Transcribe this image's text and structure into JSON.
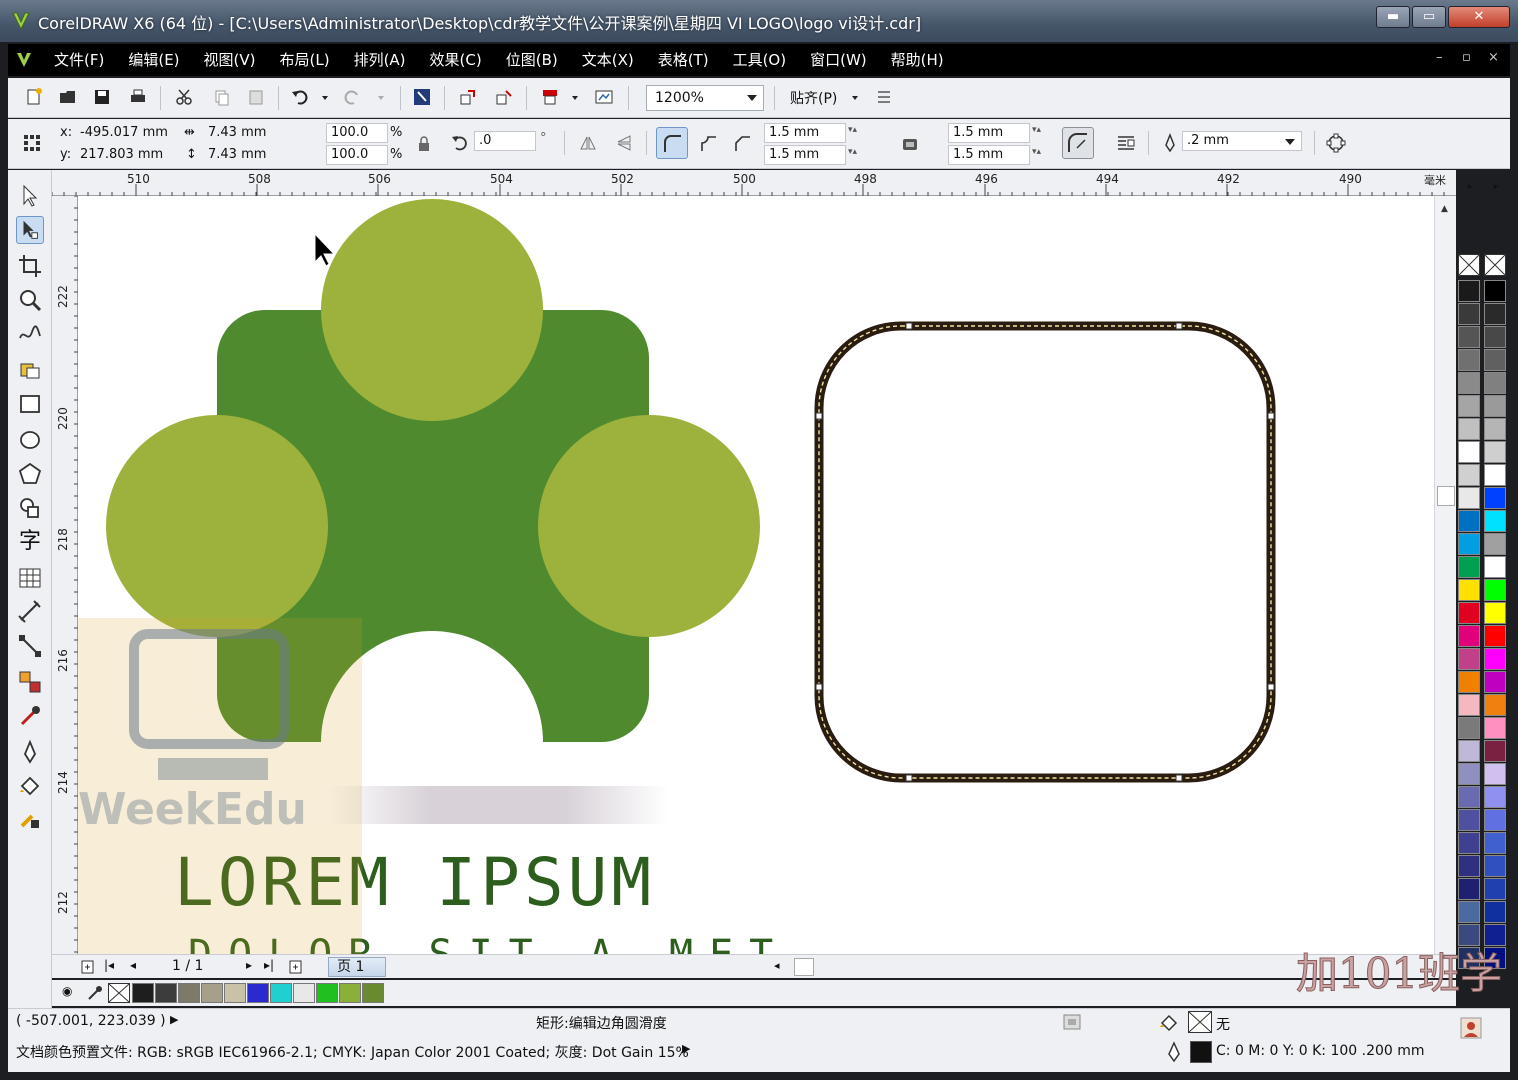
{
  "window": {
    "title": "CorelDRAW X6 (64 位) - [C:\\Users\\Administrator\\Desktop\\cdr教学文件\\公开课案例\\星期四 VI LOGO\\logo vi设计.cdr]",
    "minimize": "▬",
    "maximize": "▭",
    "close": "✕"
  },
  "menu": {
    "items": [
      "文件(F)",
      "编辑(E)",
      "视图(V)",
      "布局(L)",
      "排列(A)",
      "效果(C)",
      "位图(B)",
      "文本(X)",
      "表格(T)",
      "工具(O)",
      "窗口(W)",
      "帮助(H)"
    ],
    "doc_controls": [
      "–",
      "▫",
      "×"
    ]
  },
  "toolbar": {
    "zoom": "1200%",
    "snap_label": "贴齐(P)"
  },
  "properties": {
    "x_label": "x:",
    "x_value": "-495.017 mm",
    "y_label": "y:",
    "y_value": "217.803 mm",
    "width": "7.43 mm",
    "height": "7.43 mm",
    "scale_x": "100.0",
    "scale_y": "100.0",
    "percent": "%",
    "rotation": ".0",
    "degree": "°",
    "corner_tl": "1.5 mm",
    "corner_bl": "1.5 mm",
    "corner_tr": "1.5 mm",
    "corner_br": "1.5 mm",
    "outline_width": ".2 mm"
  },
  "ruler": {
    "unit": "毫米",
    "top_labels": [
      "510",
      "508",
      "506",
      "504",
      "502",
      "500",
      "498",
      "496",
      "494",
      "492",
      "490"
    ],
    "left_labels": [
      "222",
      "220",
      "218",
      "216",
      "214",
      "212"
    ]
  },
  "canvas": {
    "logo_text": "LOREM IPSUM",
    "logo_subtext": "DOLOR SIT A MET",
    "colors": {
      "dark_green": "#4f8a2e",
      "light_green": "#9db23c",
      "text_green": "#2e5e1e",
      "outline": "#2a1c10"
    }
  },
  "pages": {
    "counter": "1 / 1",
    "tab": "页 1"
  },
  "status": {
    "coords": "( -507.001, 223.039 )",
    "message": "矩形:编辑边角圆滑度",
    "fill_label": "无",
    "outline_info": "C: 0 M: 0 Y: 0 K: 100  .200 mm",
    "color_profile": "文档颜色预置文件: RGB: sRGB IEC61966-2.1; CMYK: Japan Color 2001 Coated; 灰度: Dot Gain 15%"
  },
  "palette_right": {
    "column1": [
      "#1a1a1a",
      "#3a3a3a",
      "#555555",
      "#707070",
      "#8a8a8a",
      "#a5a5a5",
      "#c0c0c0",
      "#ffffff",
      "#d0d0d0",
      "#e8e8e8",
      "#0070c0",
      "#00a0e0",
      "#00a050",
      "#ffe000",
      "#e00020",
      "#e0007a",
      "#c0408a",
      "#f08000",
      "#f5b8c0",
      "#7a7a7a",
      "#c0b8d8",
      "#9090c0",
      "#6a6ab0",
      "#5050a0",
      "#404090",
      "#303080",
      "#202070",
      "#4a6aa0",
      "#3a4a80",
      "#203060"
    ],
    "column2": [
      "#000000",
      "#2a2a2a",
      "#484848",
      "#606060",
      "#808080",
      "#9a9a9a",
      "#b5b5b5",
      "#cfcfcf",
      "#ffffff",
      "#0040ff",
      "#00e0ff",
      "#a0a0a0",
      "#ffffff",
      "#00ff00",
      "#ffff00",
      "#ff0000",
      "#ff00ff",
      "#c000c0",
      "#f08010",
      "#ff90c0",
      "#7a2040",
      "#d0c0f0",
      "#9090f0",
      "#6070e0",
      "#4060d0",
      "#3050c0",
      "#2040b0",
      "#1030a0",
      "#102090",
      "#001080"
    ]
  },
  "doc_palette": [
    "#1e1e1e",
    "#3c3c3c",
    "#7d7a6a",
    "#a6a08a",
    "#c9c2a8",
    "#2a2ad0",
    "#20d0d0",
    "#e8e8e8",
    "#20c020",
    "#8ab03a",
    "#6a8a30"
  ],
  "watermark_brand": "加101班学"
}
